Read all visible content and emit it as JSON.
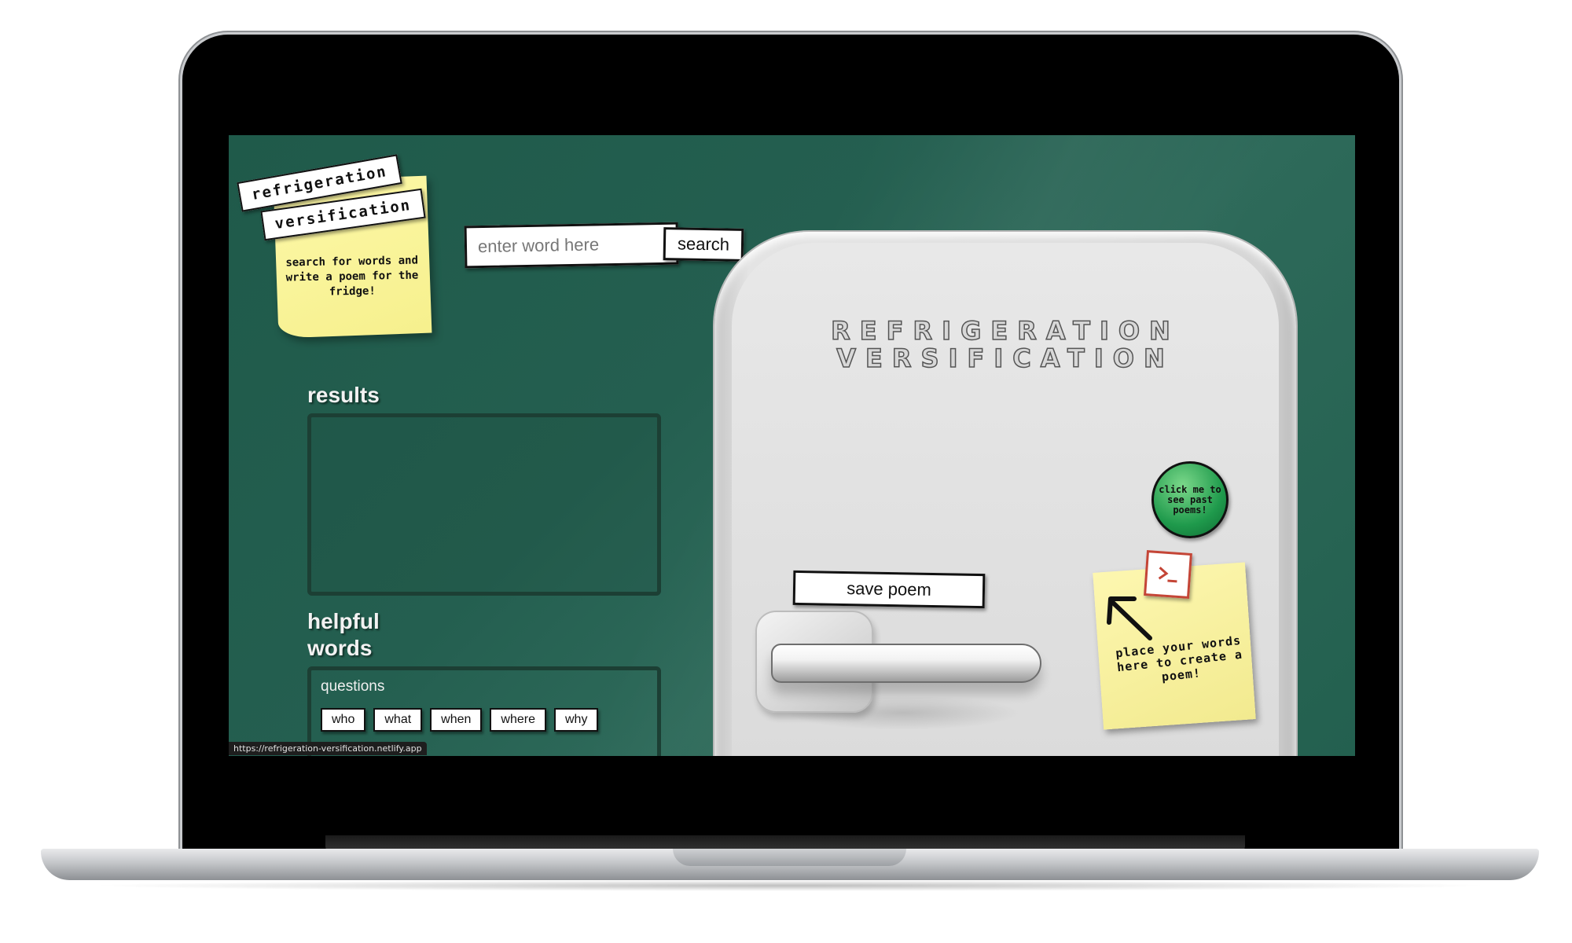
{
  "app": {
    "url": "https://refrigeration-versification.netlify.app"
  },
  "logo": {
    "word1": "refrigeration",
    "word2": "versification",
    "tagline": "search for words and write a poem for the fridge!"
  },
  "search": {
    "placeholder": "enter word here",
    "button_label": "search"
  },
  "results": {
    "label": "results"
  },
  "helpful_words": {
    "label": "helpful words",
    "groups": [
      {
        "label": "questions",
        "words": [
          "who",
          "what",
          "when",
          "where",
          "why"
        ]
      }
    ]
  },
  "fridge": {
    "title_line1": "REFRIGERATION",
    "title_line2": "VERSIFICATION",
    "past_poems_label": "click me to see past poems!",
    "save_label": "save poem",
    "drop_zone_label": "place your words here to create a poem!",
    "terminal_icon": "terminal-icon"
  },
  "colors": {
    "background": "#245f50",
    "sticky": "#f6f08d",
    "past_poems_button": "#1f9a4c",
    "terminal_accent": "#c44536"
  }
}
